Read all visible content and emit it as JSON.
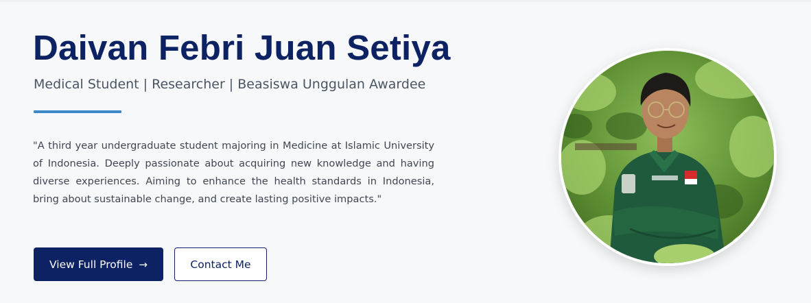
{
  "profile": {
    "name": "Daivan Febri Juan Setiya",
    "tagline": "Medical Student | Researcher | Beasiswa Unggulan Awardee",
    "bio": "\"A third year undergraduate student majoring in Medicine at Islamic University of Indonesia. Deeply passionate about acquiring new knowledge and having diverse experiences. Aiming to enhance the health standards in Indonesia, bring about sustainable change, and create lasting positive impacts.\""
  },
  "actions": {
    "primary_label": "View Full Profile",
    "primary_icon": "arrow-right-icon",
    "secondary_label": "Contact Me"
  },
  "colors": {
    "brand_navy": "#0d2263",
    "accent_blue": "#3d87c9",
    "background": "#f7f8fa"
  }
}
